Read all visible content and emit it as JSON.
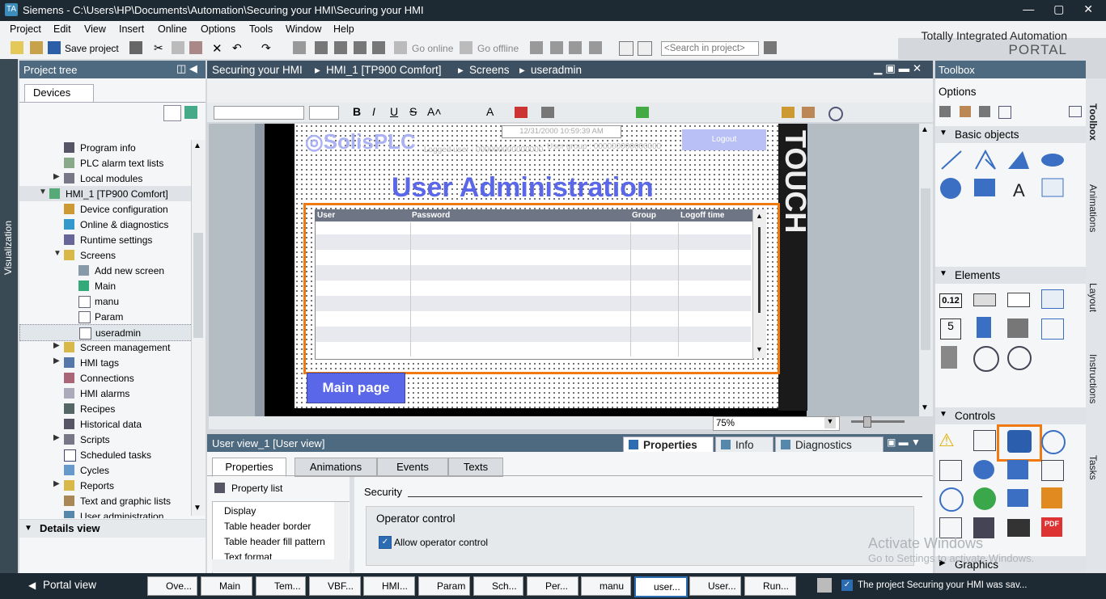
{
  "window": {
    "title": "Siemens  -  C:\\Users\\HP\\Documents\\Automation\\Securing your HMI\\Securing your HMI",
    "controls": "— ▢ ✕"
  },
  "menu": [
    "Project",
    "Edit",
    "View",
    "Insert",
    "Online",
    "Options",
    "Tools",
    "Window",
    "Help"
  ],
  "brand": {
    "line1": "Totally Integrated Automation",
    "line2": "PORTAL"
  },
  "toolbar": {
    "save_project": "Save project",
    "go_online": "Go online",
    "go_offline": "Go offline",
    "search_placeholder": "<Search in project>"
  },
  "side_strip": "Visualization",
  "project_tree": {
    "title": "Project tree",
    "tab": "Devices",
    "items": [
      {
        "label": "Program info"
      },
      {
        "label": "PLC alarm text lists"
      },
      {
        "label": "Local modules"
      },
      {
        "label": "HMI_1 [TP900 Comfort]"
      },
      {
        "label": "Device configuration"
      },
      {
        "label": "Online & diagnostics"
      },
      {
        "label": "Runtime settings"
      },
      {
        "label": "Screens"
      },
      {
        "label": "Add new screen"
      },
      {
        "label": "Main"
      },
      {
        "label": "manu"
      },
      {
        "label": "Param"
      },
      {
        "label": "useradmin"
      },
      {
        "label": "Screen management"
      },
      {
        "label": "HMI tags"
      },
      {
        "label": "Connections"
      },
      {
        "label": "HMI alarms"
      },
      {
        "label": "Recipes"
      },
      {
        "label": "Historical data"
      },
      {
        "label": "Scripts"
      },
      {
        "label": "Scheduled tasks"
      },
      {
        "label": "Cycles"
      },
      {
        "label": "Reports"
      },
      {
        "label": "Text and graphic lists"
      },
      {
        "label": "User administration"
      }
    ],
    "details_view": "Details view"
  },
  "editor": {
    "breadcrumb": [
      "Securing your HMI",
      "HMI_1 [TP900 Comfort]",
      "Screens",
      "useradmin"
    ],
    "screen": {
      "logo": "◎SolisPLC",
      "date": "12/31/2000 10:59:39 AM",
      "logged_user": "Logged user :  000000000000000",
      "user_group": "User group :  000000000000000",
      "logout": "Logout",
      "title": "User Administration",
      "touch": "TOUCH",
      "user_view_headers": [
        "User",
        "Password",
        "Group",
        "Logoff time"
      ],
      "main_page": "Main page"
    },
    "zoom": "75%"
  },
  "properties": {
    "title": "User view_1 [User view]",
    "top_tabs": [
      "Properties",
      "Info",
      "Diagnostics"
    ],
    "tabs": [
      "Properties",
      "Animations",
      "Events",
      "Texts"
    ],
    "property_list_label": "Property list",
    "property_list": [
      "Display",
      "Table header border",
      "Table header fill pattern",
      "Text format"
    ],
    "section": "Security",
    "group": "Operator control",
    "checkbox_label": "Allow operator control"
  },
  "toolbox": {
    "title": "Toolbox",
    "options": "Options",
    "sections": [
      "Basic objects",
      "Elements",
      "Controls",
      "Graphics"
    ],
    "element_value": "0.12"
  },
  "right_tabs": [
    "Toolbox",
    "Animations",
    "Layout",
    "Instructions",
    "Tasks"
  ],
  "watermark": {
    "line1": "Activate Windows",
    "line2": "Go to Settings to activate Windows."
  },
  "statusbar": {
    "portal_view": "Portal view",
    "tasks": [
      "Ove...",
      "Main",
      "Tem...",
      "VBF...",
      "HMI...",
      "Param",
      "Sch...",
      "Per...",
      "manu",
      "user...",
      "User...",
      "Run..."
    ],
    "message": "The project Securing your HMI was sav..."
  }
}
